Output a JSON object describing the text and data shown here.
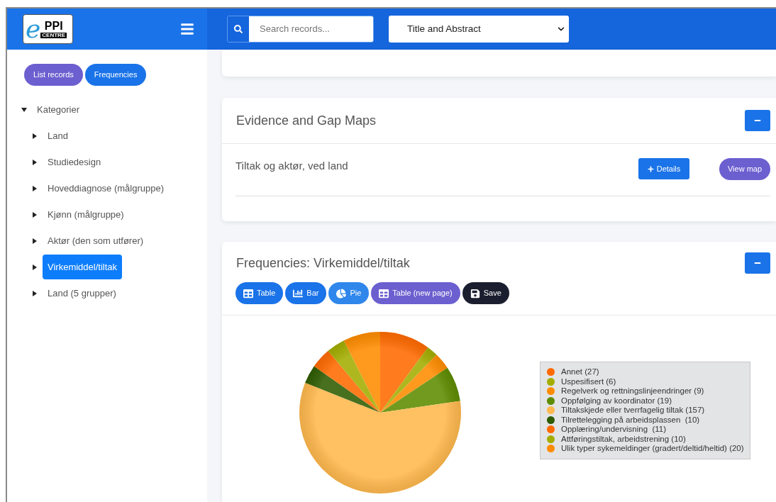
{
  "header": {
    "logo": {
      "letter": "e",
      "text": "PPI",
      "sub": "CENTRE"
    },
    "search": {
      "placeholder": "Search records..."
    },
    "field_select": {
      "value": "Title and Abstract"
    }
  },
  "sidebar": {
    "buttons": [
      {
        "label": "List records",
        "kind": "secondary"
      },
      {
        "label": "Frequencies",
        "kind": "primary"
      }
    ],
    "tree": [
      {
        "label": "Kategorier",
        "expanded": true,
        "selected": false,
        "children": [
          {
            "label": "Land",
            "expanded": false,
            "selected": false
          },
          {
            "label": "Studiedesign",
            "expanded": false,
            "selected": false
          },
          {
            "label": "Hoveddiagnose (målgruppe)",
            "expanded": false,
            "selected": false
          },
          {
            "label": "Kjønn (målgruppe)",
            "expanded": false,
            "selected": false
          },
          {
            "label": "Aktør (den som utfører)",
            "expanded": false,
            "selected": false
          },
          {
            "label": "Virkemiddel/tiltak",
            "expanded": false,
            "selected": true
          },
          {
            "label": "Land (5 grupper)",
            "expanded": false,
            "selected": false
          }
        ]
      }
    ]
  },
  "evidence_maps": {
    "title": "Evidence and Gap Maps",
    "maps": [
      {
        "name": "Tiltak og aktør, ved land",
        "details_button": "Details",
        "view_button": "View map"
      }
    ]
  },
  "frequencies": {
    "title": "Frequencies: Virkemiddel/tiltak",
    "toolbar": [
      {
        "label": "Table",
        "kind": "table",
        "selected": false
      },
      {
        "label": "Bar",
        "kind": "bar",
        "selected": false
      },
      {
        "label": "Pie",
        "kind": "pie",
        "selected": true
      },
      {
        "label": "Table (new page)",
        "kind": "newpage",
        "selected": false
      },
      {
        "label": "Save",
        "kind": "save",
        "selected": false
      }
    ],
    "legend": [
      {
        "label": "Annet (27)",
        "color": "#ff6a00"
      },
      {
        "label": "Uspesifisert (6)",
        "color": "#a3ad00"
      },
      {
        "label": "Regelverk og rettningslinjeendringer (9)",
        "color": "#ff8c00"
      },
      {
        "label": "Oppfølging av koordinator (19)",
        "color": "#5e8c00"
      },
      {
        "label": "Tiltakskjede eller tverrfagelig tiltak (157)",
        "color": "#ffb84d"
      },
      {
        "label": "Tilrettelegging på arbeidsplassen  (10)",
        "color": "#2e5c00"
      },
      {
        "label": "Opplæring/undervisning  (11)",
        "color": "#ff6a00"
      },
      {
        "label": "Attføringstiltak, arbeidstrening (10)",
        "color": "#a3ad00"
      },
      {
        "label": "Ulik typer sykemeldinger (gradert/deltid/heltid) (20)",
        "color": "#ff8c00"
      }
    ],
    "chart_data": {
      "type": "pie",
      "values": [
        10.04,
        2.23,
        3.35,
        7.06,
        58.36,
        3.72,
        4.09,
        3.72,
        7.43
      ]
    }
  }
}
